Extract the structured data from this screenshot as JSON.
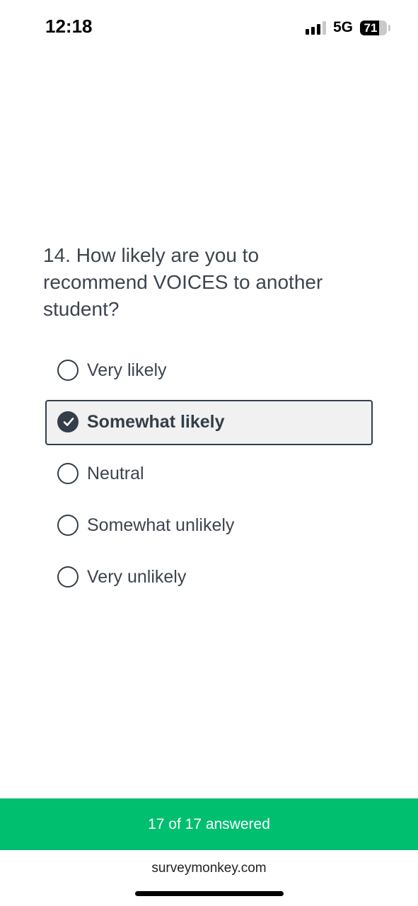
{
  "status_bar": {
    "time": "12:18",
    "network": "5G",
    "battery_level": "71",
    "battery_fraction": 0.71,
    "signal_bars_active": 3,
    "signal_bars_total": 4
  },
  "question": {
    "text": "14. How likely are you to recommend VOICES to another student?"
  },
  "options": [
    {
      "label": "Very likely",
      "selected": false
    },
    {
      "label": "Somewhat likely",
      "selected": true
    },
    {
      "label": "Neutral",
      "selected": false
    },
    {
      "label": "Somewhat unlikely",
      "selected": false
    },
    {
      "label": "Very unlikely",
      "selected": false
    }
  ],
  "progress": {
    "text": "17 of 17 answered",
    "answered": 17,
    "total": 17
  },
  "footer": {
    "link_text": "surveymonkey.com"
  },
  "colors": {
    "accent": "#00bf6f",
    "text": "#333e48"
  },
  "icons": {
    "selected_option": "checkmark-icon",
    "unselected_option": "radio-circle-icon",
    "signal": "cellular-signal-icon",
    "battery": "battery-icon"
  }
}
